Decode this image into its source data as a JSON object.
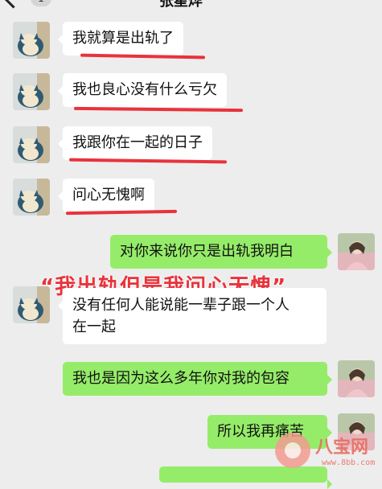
{
  "header": {
    "title": "张星烨",
    "unread_count": "1",
    "back_icon": "chevron-left-icon"
  },
  "messages": [
    {
      "side": "left",
      "text": "我就算是出轨了",
      "underlined": true
    },
    {
      "side": "left",
      "text": "我也良心没有什么亏欠",
      "underlined": true
    },
    {
      "side": "left",
      "text": "我跟你在一起的日子",
      "underlined": true
    },
    {
      "side": "left",
      "text": "问心无愧啊",
      "underlined": true
    },
    {
      "side": "right",
      "text": "对你来说你只是出轨我明白"
    },
    {
      "side": "left",
      "text_lines": [
        "没有任何人能说能一辈子跟一个人",
        "在一起"
      ]
    },
    {
      "side": "right",
      "text": "我也是因为这么多年你对我的包容"
    },
    {
      "side": "right",
      "text": "所以我再痛苦"
    }
  ],
  "overlay_caption": "“我出轨但是我问心无愧”",
  "watermark": {
    "name": "八宝网",
    "url": "www.8bb.com"
  },
  "colors": {
    "background": "#ededed",
    "bubble_left": "#ffffff",
    "bubble_right": "#95ec69",
    "highlight_red": "#e8333b"
  }
}
